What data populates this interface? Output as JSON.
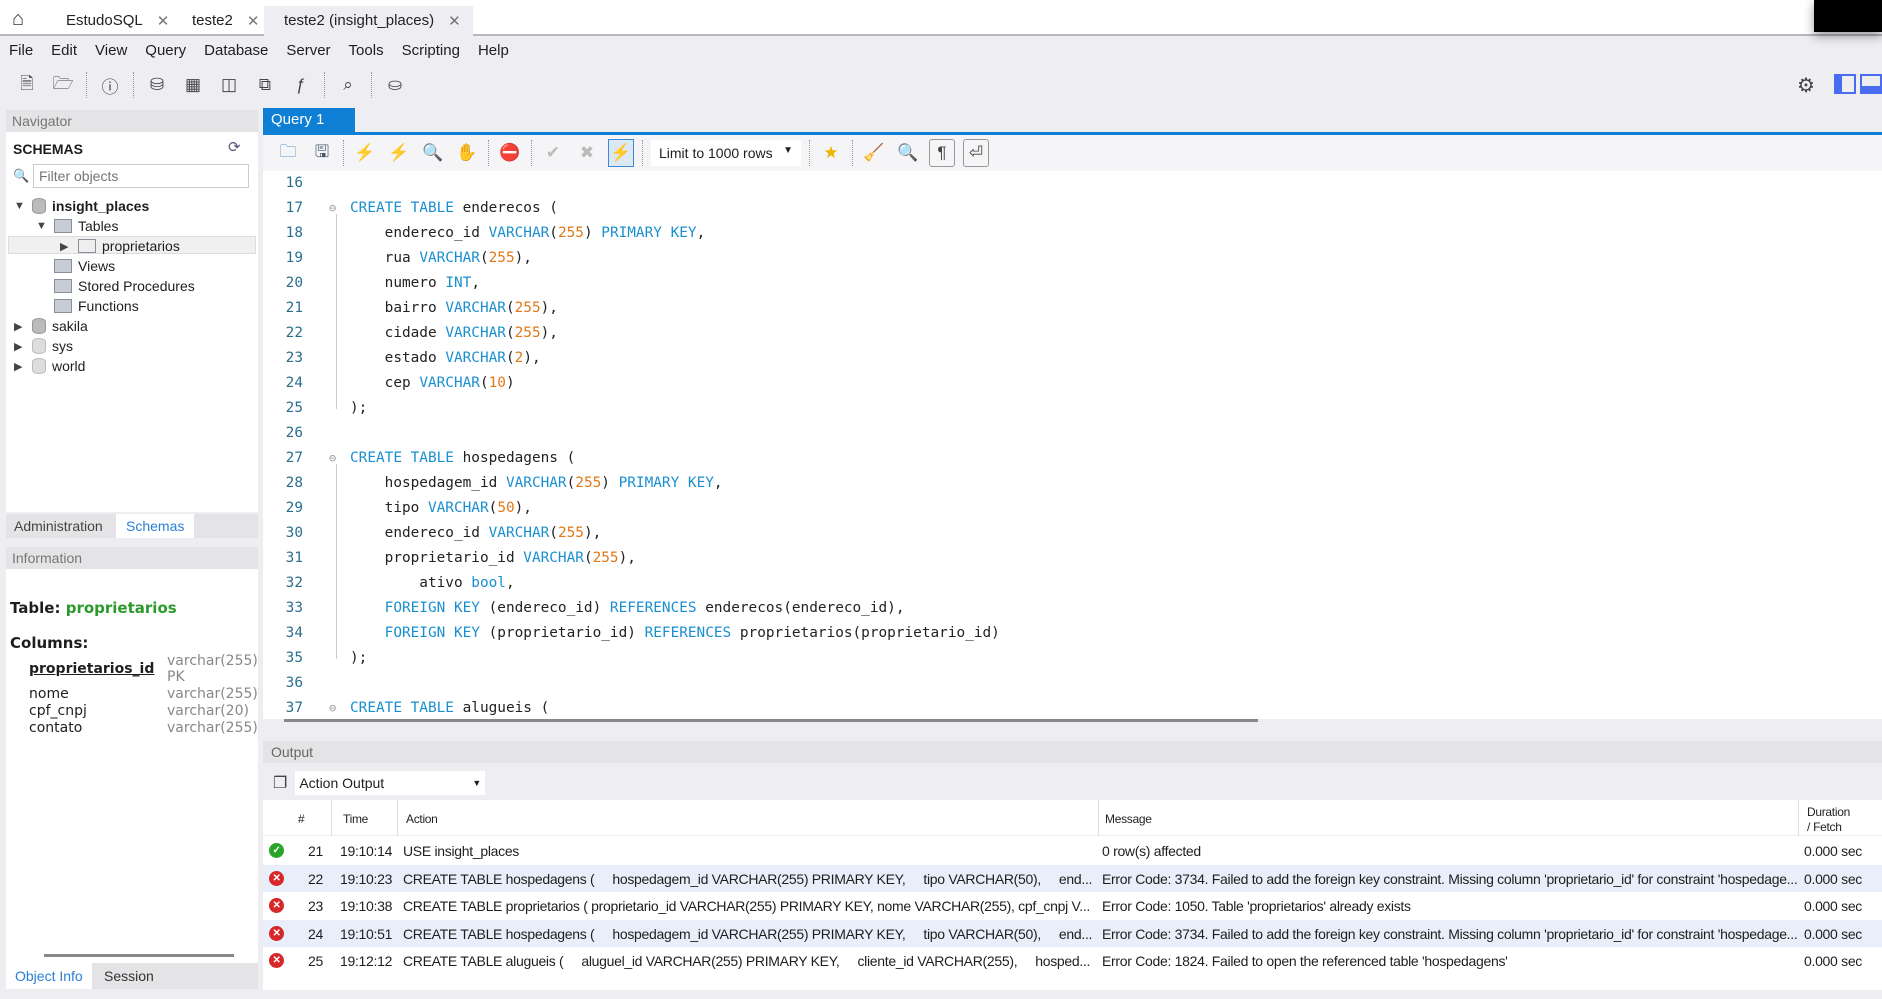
{
  "file_tabs": [
    {
      "label": "EstudoSQL"
    },
    {
      "label": "teste2"
    },
    {
      "label": "teste2 (insight_places)",
      "active": true
    }
  ],
  "menu": [
    "File",
    "Edit",
    "View",
    "Query",
    "Database",
    "Server",
    "Tools",
    "Scripting",
    "Help"
  ],
  "navigator": {
    "title": "Navigator",
    "schemas_label": "SCHEMAS",
    "filter_placeholder": "Filter objects",
    "tree": {
      "schema": "insight_places",
      "tables": "Tables",
      "table": "proprietarios",
      "views": "Views",
      "procs": "Stored Procedures",
      "funcs": "Functions",
      "others": [
        "sakila",
        "sys",
        "world"
      ]
    }
  },
  "left_tabs": {
    "admin": "Administration",
    "schemas": "Schemas"
  },
  "information": {
    "title": "Information",
    "table_label": "Table:",
    "table_name": "proprietarios",
    "columns_label": "Columns:",
    "columns": [
      {
        "name": "proprietarios_id",
        "type": "varchar(255)",
        "extra": "PK"
      },
      {
        "name": "nome",
        "type": "varchar(255)"
      },
      {
        "name": "cpf_cnpj",
        "type": "varchar(20)"
      },
      {
        "name": "contato",
        "type": "varchar(255)"
      }
    ]
  },
  "bottom_tabs": {
    "object_info": "Object Info",
    "session": "Session"
  },
  "query_tab": "Query 1",
  "limit_select": "Limit to 1000 rows",
  "accent": "#0f7fd6",
  "code": [
    {
      "n": "16",
      "t": []
    },
    {
      "n": "17",
      "f": true,
      "t": [
        [
          "kw",
          "CREATE TABLE "
        ],
        [
          "id",
          "enderecos ("
        ]
      ]
    },
    {
      "n": "18",
      "t": [
        [
          "id",
          "    endereco_id "
        ],
        [
          "kw",
          "VARCHAR"
        ],
        [
          "id",
          "("
        ],
        [
          "num",
          "255"
        ],
        [
          "id",
          ") "
        ],
        [
          "kw",
          "PRIMARY KEY"
        ],
        [
          "id",
          ","
        ]
      ]
    },
    {
      "n": "19",
      "t": [
        [
          "id",
          "    rua "
        ],
        [
          "kw",
          "VARCHAR"
        ],
        [
          "id",
          "("
        ],
        [
          "num",
          "255"
        ],
        [
          "id",
          "),"
        ]
      ]
    },
    {
      "n": "20",
      "t": [
        [
          "id",
          "    numero "
        ],
        [
          "kw",
          "INT"
        ],
        [
          "id",
          ","
        ]
      ]
    },
    {
      "n": "21",
      "t": [
        [
          "id",
          "    bairro "
        ],
        [
          "kw",
          "VARCHAR"
        ],
        [
          "id",
          "("
        ],
        [
          "num",
          "255"
        ],
        [
          "id",
          "),"
        ]
      ]
    },
    {
      "n": "22",
      "t": [
        [
          "id",
          "    cidade "
        ],
        [
          "kw",
          "VARCHAR"
        ],
        [
          "id",
          "("
        ],
        [
          "num",
          "255"
        ],
        [
          "id",
          "),"
        ]
      ]
    },
    {
      "n": "23",
      "t": [
        [
          "id",
          "    estado "
        ],
        [
          "kw",
          "VARCHAR"
        ],
        [
          "id",
          "("
        ],
        [
          "num",
          "2"
        ],
        [
          "id",
          "),"
        ]
      ]
    },
    {
      "n": "24",
      "t": [
        [
          "id",
          "    cep "
        ],
        [
          "kw",
          "VARCHAR"
        ],
        [
          "id",
          "("
        ],
        [
          "num",
          "10"
        ],
        [
          "id",
          ")"
        ]
      ]
    },
    {
      "n": "25",
      "t": [
        [
          "id",
          ");"
        ]
      ]
    },
    {
      "n": "26",
      "t": []
    },
    {
      "n": "27",
      "f": true,
      "t": [
        [
          "kw",
          "CREATE TABLE "
        ],
        [
          "id",
          "hospedagens ("
        ]
      ]
    },
    {
      "n": "28",
      "t": [
        [
          "id",
          "    hospedagem_id "
        ],
        [
          "kw",
          "VARCHAR"
        ],
        [
          "id",
          "("
        ],
        [
          "num",
          "255"
        ],
        [
          "id",
          ") "
        ],
        [
          "kw",
          "PRIMARY KEY"
        ],
        [
          "id",
          ","
        ]
      ]
    },
    {
      "n": "29",
      "t": [
        [
          "id",
          "    tipo "
        ],
        [
          "kw",
          "VARCHAR"
        ],
        [
          "id",
          "("
        ],
        [
          "num",
          "50"
        ],
        [
          "id",
          "),"
        ]
      ]
    },
    {
      "n": "30",
      "t": [
        [
          "id",
          "    endereco_id "
        ],
        [
          "kw",
          "VARCHAR"
        ],
        [
          "id",
          "("
        ],
        [
          "num",
          "255"
        ],
        [
          "id",
          "),"
        ]
      ]
    },
    {
      "n": "31",
      "t": [
        [
          "id",
          "    proprietario_id "
        ],
        [
          "kw",
          "VARCHAR"
        ],
        [
          "id",
          "("
        ],
        [
          "num",
          "255"
        ],
        [
          "id",
          "),"
        ]
      ]
    },
    {
      "n": "32",
      "t": [
        [
          "id",
          "        ativo "
        ],
        [
          "kw",
          "bool"
        ],
        [
          "id",
          ","
        ]
      ]
    },
    {
      "n": "33",
      "t": [
        [
          "kw",
          "    FOREIGN KEY "
        ],
        [
          "id",
          "(endereco_id) "
        ],
        [
          "kw",
          "REFERENCES "
        ],
        [
          "id",
          "enderecos(endereco_id),"
        ]
      ]
    },
    {
      "n": "34",
      "t": [
        [
          "kw",
          "    FOREIGN KEY "
        ],
        [
          "id",
          "(proprietario_id) "
        ],
        [
          "kw",
          "REFERENCES "
        ],
        [
          "id",
          "proprietarios(proprietario_id)"
        ]
      ]
    },
    {
      "n": "35",
      "t": [
        [
          "id",
          ");"
        ]
      ]
    },
    {
      "n": "36",
      "t": []
    },
    {
      "n": "37",
      "f": true,
      "t": [
        [
          "kw",
          "CREATE TABLE "
        ],
        [
          "id",
          "alugueis ("
        ]
      ]
    }
  ],
  "output": {
    "title": "Output",
    "selector": "Action Output",
    "headers": {
      "num": "#",
      "time": "Time",
      "action": "Action",
      "message": "Message",
      "duration": "Duration\n/ Fetch"
    },
    "rows": [
      {
        "status": "ok",
        "num": "21",
        "time": "19:10:14",
        "action": "USE insight_places",
        "message": "0 row(s) affected",
        "duration": "0.000 sec"
      },
      {
        "status": "error",
        "num": "22",
        "time": "19:10:23",
        "action": "CREATE TABLE hospedagens (     hospedagem_id VARCHAR(255) PRIMARY KEY,     tipo VARCHAR(50),     end...",
        "message": "Error Code: 3734. Failed to add the foreign key constraint. Missing column 'proprietario_id' for constraint 'hospedage...",
        "duration": "0.000 sec"
      },
      {
        "status": "error",
        "num": "23",
        "time": "19:10:38",
        "action": "CREATE TABLE proprietarios ( proprietario_id VARCHAR(255) PRIMARY KEY, nome VARCHAR(255), cpf_cnpj V...",
        "message": "Error Code: 1050. Table 'proprietarios' already exists",
        "duration": "0.000 sec"
      },
      {
        "status": "error",
        "num": "24",
        "time": "19:10:51",
        "action": "CREATE TABLE hospedagens (     hospedagem_id VARCHAR(255) PRIMARY KEY,     tipo VARCHAR(50),     end...",
        "message": "Error Code: 3734. Failed to add the foreign key constraint. Missing column 'proprietario_id' for constraint 'hospedage...",
        "duration": "0.000 sec"
      },
      {
        "status": "error",
        "num": "25",
        "time": "19:12:12",
        "action": "CREATE TABLE alugueis (     aluguel_id VARCHAR(255) PRIMARY KEY,     cliente_id VARCHAR(255),     hosped...",
        "message": "Error Code: 1824. Failed to open the referenced table 'hospedagens'",
        "duration": "0.000 sec"
      }
    ]
  }
}
